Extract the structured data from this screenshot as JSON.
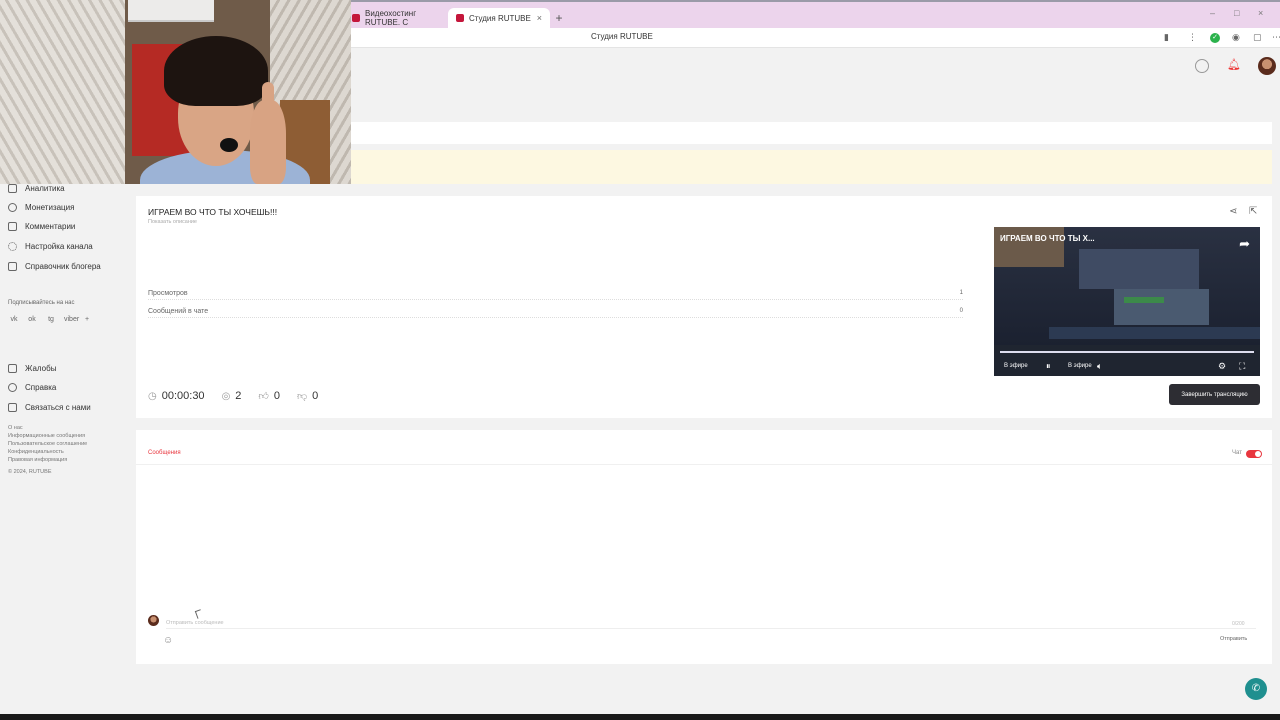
{
  "browser": {
    "tabs": [
      {
        "label": "Видеохостинг RUTUBE. С"
      },
      {
        "label": "Студия RUTUBE"
      }
    ],
    "new_tab": "+",
    "close": "×",
    "window_controls": [
      "–",
      "□",
      "×"
    ],
    "page_title": "Студия RUTUBE"
  },
  "sidebar": {
    "items": [
      {
        "label": "Аналитика",
        "icon": "analytics-icon"
      },
      {
        "label": "Монетизация",
        "icon": "coin-icon"
      },
      {
        "label": "Комментарии",
        "icon": "comment-icon"
      },
      {
        "label": "Настройка канала",
        "icon": "gear-icon"
      },
      {
        "label": "Справочник блогера",
        "icon": "book-icon"
      }
    ],
    "subscribe_label": "Подписывайтесь на нас",
    "socials": [
      "vk",
      "ok",
      "tg",
      "viber",
      "+"
    ],
    "secondary": [
      {
        "label": "Жалобы",
        "icon": "flag-icon"
      },
      {
        "label": "Справка",
        "icon": "question-icon"
      },
      {
        "label": "Связаться с нами",
        "icon": "mail-icon"
      }
    ],
    "footer_links": [
      "О нас",
      "Информационные сообщения",
      "Пользовательское соглашение",
      "Конфиденциальность",
      "Правовая информация",
      "© 2024, RUTUBE"
    ]
  },
  "stream": {
    "title": "ИГРАЕМ ВО ЧТО ТЫ ХОЧЕШЬ!!!",
    "description_link": "Показать описание",
    "stats": [
      {
        "label": "Просмотров",
        "value": "1"
      },
      {
        "label": "Сообщений в чате",
        "value": "0"
      }
    ],
    "duration": "00:00:30",
    "viewers": "2",
    "likes": "0",
    "dislikes": "0",
    "end_button": "Завершить трансляцию"
  },
  "player": {
    "title": "ИГРАЕМ ВО ЧТО ТЫ Х...",
    "live_badge": "В эфире",
    "live_label": "В эфире",
    "progress": 1.0
  },
  "chat": {
    "tab_label": "Сообщения",
    "toggle_label": "Чат",
    "toggle_on": true,
    "placeholder": "Отправить сообщение",
    "char_count": "0/200",
    "send_label": "Отправить"
  },
  "colors": {
    "accent": "#e8363e",
    "button_dark": "#2d2d33",
    "fab": "#1f8f8f",
    "banner": "#fdf8e1"
  }
}
